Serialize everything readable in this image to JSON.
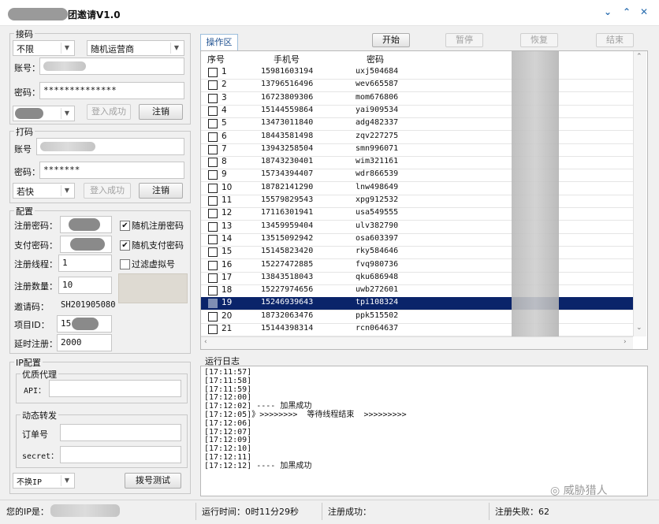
{
  "window": {
    "title_suffix": "团邀请V1.0",
    "controls": [
      "chevron-down",
      "chevron-up",
      "close"
    ]
  },
  "receive": {
    "section": "接码",
    "carrier_filter": "不限",
    "operator": "随机运营商",
    "account_label": "账号：",
    "password_label": "密码：",
    "password_value": "**************",
    "login_button": "登入成功",
    "logout_button": "注销"
  },
  "fight": {
    "section": "打码",
    "account_label": "账号",
    "password_label": "密码：",
    "password_value": "*******",
    "platform": "若快",
    "login_button": "登入成功",
    "logout_button": "注销"
  },
  "config": {
    "section": "配置",
    "reg_password_label": "注册密码：",
    "random_reg_password_label": "随机注册密码",
    "random_reg_password_checked": true,
    "pay_password_label": "支付密码：",
    "random_pay_password_label": "随机支付密码",
    "random_pay_password_checked": true,
    "threads_label": "注册线程：",
    "threads_value": "1",
    "filter_virtual_label": "过滤虚拟号",
    "filter_virtual_checked": false,
    "count_label": "注册数量：",
    "count_value": "10",
    "invite_code_label": "邀请码：",
    "invite_code_value": "SH201905080",
    "project_id_label": "项目ID：",
    "project_id_value": "15",
    "delay_label": "延时注册：",
    "delay_value": "2000"
  },
  "ip": {
    "section": "IP配置",
    "proxy_section": "优质代理",
    "api_label": "API：",
    "dynamic_section": "动态转发",
    "order_label": "订单号",
    "secret_label": "secret：",
    "ip_mode": "不换IP",
    "dial_test_button": "拨号测试"
  },
  "workspace": {
    "tab": "操作区",
    "start_button": "开始",
    "pause_button": "暂停",
    "resume_button": "恢复",
    "end_button": "结束",
    "columns": [
      "序号",
      "手机号",
      "密码"
    ],
    "selected_row": 19,
    "rows": [
      {
        "no": "1",
        "phone": "15981603194",
        "password": "uxj504684"
      },
      {
        "no": "2",
        "phone": "13796516496",
        "password": "wev665587"
      },
      {
        "no": "3",
        "phone": "16723809306",
        "password": "mom676806"
      },
      {
        "no": "4",
        "phone": "15144559864",
        "password": "yai909534"
      },
      {
        "no": "5",
        "phone": "13473011840",
        "password": "adg482337"
      },
      {
        "no": "6",
        "phone": "18443581498",
        "password": "zqv227275"
      },
      {
        "no": "7",
        "phone": "13943258504",
        "password": "smn996071"
      },
      {
        "no": "8",
        "phone": "18743230401",
        "password": "wim321161"
      },
      {
        "no": "9",
        "phone": "15734394407",
        "password": "wdr866539"
      },
      {
        "no": "10",
        "phone": "18782141290",
        "password": "lnw498649"
      },
      {
        "no": "11",
        "phone": "15579829543",
        "password": "xpg912532"
      },
      {
        "no": "12",
        "phone": "17116301941",
        "password": "usa549555"
      },
      {
        "no": "13",
        "phone": "13459959404",
        "password": "ulv382790"
      },
      {
        "no": "14",
        "phone": "13515092942",
        "password": "osa603397"
      },
      {
        "no": "15",
        "phone": "15145823420",
        "password": "rky584646"
      },
      {
        "no": "16",
        "phone": "15227472885",
        "password": "fvq980736"
      },
      {
        "no": "17",
        "phone": "13843518043",
        "password": "qku686948"
      },
      {
        "no": "18",
        "phone": "15227974656",
        "password": "uwb272601"
      },
      {
        "no": "19",
        "phone": "15246939643",
        "password": "tpi108324"
      },
      {
        "no": "20",
        "phone": "18732063476",
        "password": "ppk515502"
      },
      {
        "no": "21",
        "phone": "15144398314",
        "password": "rcn064637"
      }
    ]
  },
  "log": {
    "title": "运行日志",
    "lines": [
      "[17:11:57]",
      "[17:11:58]",
      "[17:11:59]",
      "[17:12:00]",
      "[17:12:02] ---- 加黑成功",
      "[17:12:05]》>>>>>>>>  等待线程结束  >>>>>>>>>",
      "[17:12:06]",
      "[17:12:07]",
      "[17:12:09]",
      "[17:12:10]",
      "[17:12:11]",
      "[17:12:12] ---- 加黑成功"
    ]
  },
  "watermark": "威胁猎人",
  "status": {
    "ip_label": "您的IP是：",
    "runtime": "运行时间：0时11分29秒",
    "reg_success": "注册成功：",
    "reg_fail": "注册失败：62"
  }
}
